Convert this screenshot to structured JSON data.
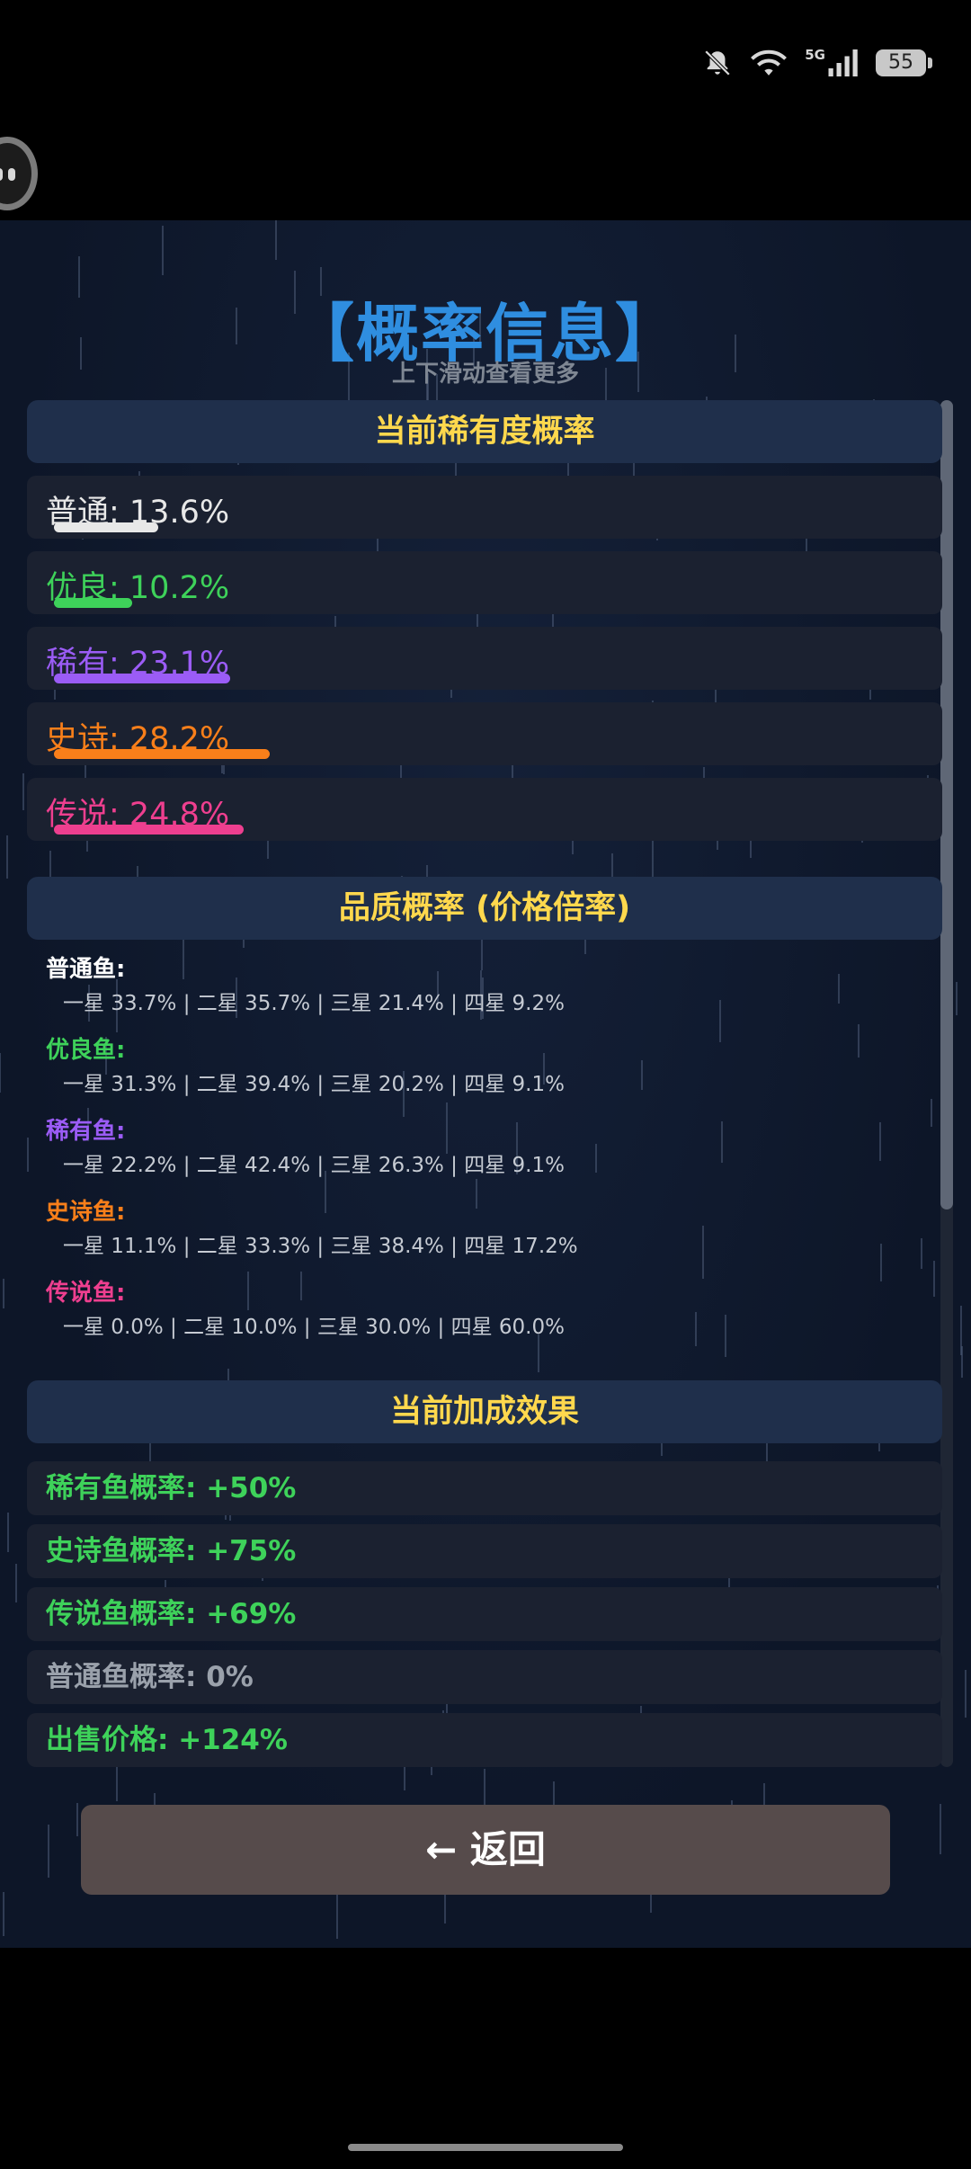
{
  "status_bar": {
    "network_label": "5G",
    "battery_level": "55",
    "icons": [
      "bell-muted-icon",
      "wifi-icon",
      "signal-icon",
      "battery-icon"
    ]
  },
  "header": {
    "title": "【概率信息】",
    "subtitle": "上下滑动查看更多"
  },
  "rarity_section": {
    "heading": "当前稀有度概率",
    "items": [
      {
        "label": "普通: 13.6%",
        "percent": 13.6,
        "color": "#e8e8e8"
      },
      {
        "label": "优良: 10.2%",
        "percent": 10.2,
        "color": "#3ed25a"
      },
      {
        "label": "稀有: 23.1%",
        "percent": 23.1,
        "color": "#9b5cf6"
      },
      {
        "label": "史诗: 28.2%",
        "percent": 28.2,
        "color": "#f97f1a"
      },
      {
        "label": "传说: 24.8%",
        "percent": 24.8,
        "color": "#ee3f8f"
      }
    ]
  },
  "quality_section": {
    "heading": "品质概率 (价格倍率)",
    "items": [
      {
        "name": "普通鱼:",
        "detail": "一星 33.7% | 二星 35.7% | 三星 21.4% | 四星 9.2%",
        "color": "#ffffff"
      },
      {
        "name": "优良鱼:",
        "detail": "一星 31.3% | 二星 39.4% | 三星 20.2% | 四星 9.1%",
        "color": "#3ed25a"
      },
      {
        "name": "稀有鱼:",
        "detail": "一星 22.2% | 二星 42.4% | 三星 26.3% | 四星 9.1%",
        "color": "#9b5cf6"
      },
      {
        "name": "史诗鱼:",
        "detail": "一星 11.1% | 二星 33.3% | 三星 38.4% | 四星 17.2%",
        "color": "#f97f1a"
      },
      {
        "name": "传说鱼:",
        "detail": "一星 0.0% | 二星 10.0% | 三星 30.0% | 四星 60.0%",
        "color": "#ee3f8f"
      }
    ]
  },
  "bonus_section": {
    "heading": "当前加成效果",
    "items": [
      {
        "label": "稀有鱼概率: +50%",
        "color": "#3ed25a"
      },
      {
        "label": "史诗鱼概率: +75%",
        "color": "#3ed25a"
      },
      {
        "label": "传说鱼概率: +69%",
        "color": "#3ed25a"
      },
      {
        "label": "普通鱼概率: 0%",
        "color": "#9aa1ab"
      },
      {
        "label": "出售价格: +124%",
        "color": "#3ed25a"
      }
    ]
  },
  "back_button": {
    "label": "← 返回"
  }
}
